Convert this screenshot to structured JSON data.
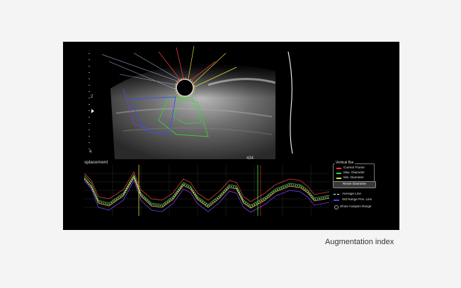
{
  "scale": {
    "label_top": "2",
    "label_bottom": "4"
  },
  "frame_number": "434",
  "plot": {
    "title": "splacement"
  },
  "legend": {
    "title": "Vertical Bar",
    "items": [
      {
        "label": "Current Frame",
        "color": "#e03b3b"
      },
      {
        "label": "Max. Diameter",
        "color": "#3bd03b"
      },
      {
        "label": "Min. Diameter",
        "color": "#e6e23a"
      }
    ]
  },
  "reset_button": {
    "label": "Reset Diameter"
  },
  "overlay_legend": {
    "average": {
      "label": "Average Line",
      "color": "#ffffff"
    },
    "range": {
      "label": "Std Range Pos. Line",
      "color": "#3b4ef0"
    },
    "analysis": {
      "label": "Show Analysis Range"
    }
  },
  "caption": "Augmentation index"
}
